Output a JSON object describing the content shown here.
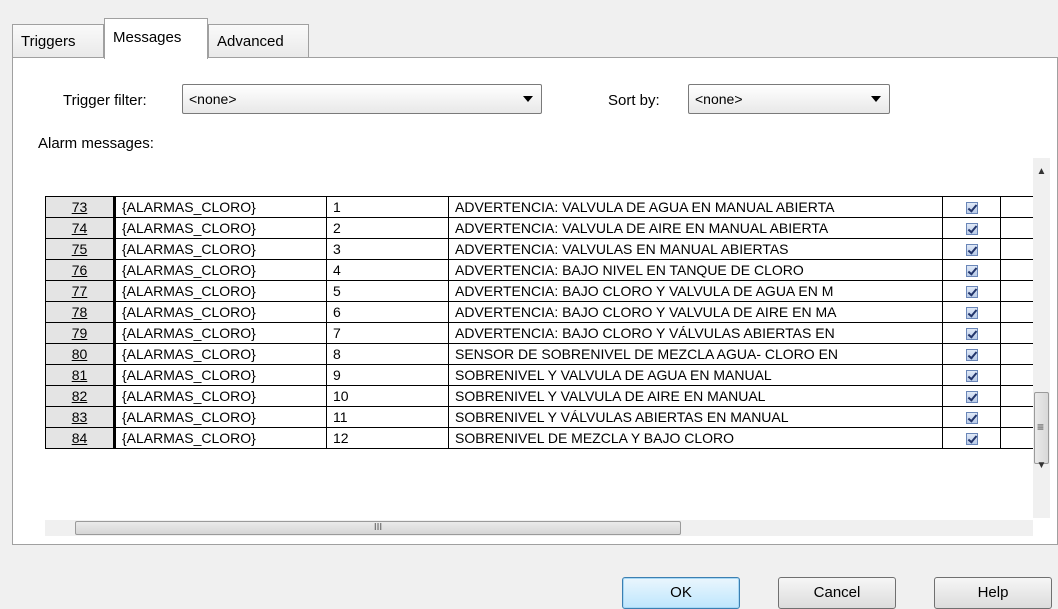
{
  "tabs": [
    "Triggers",
    "Messages",
    "Advanced"
  ],
  "filter": {
    "trigger_filter_label": "Trigger filter:",
    "trigger_filter_value": "<none>",
    "sort_by_label": "Sort by:",
    "sort_by_value": "<none>"
  },
  "alarm_messages_label": "Alarm messages:",
  "rows": [
    {
      "num": "73",
      "trigger": "{ALARMAS_CLORO}",
      "id": "1",
      "text": "ADVERTENCIA: VALVULA DE AGUA EN MANUAL ABIERTA",
      "checked": true
    },
    {
      "num": "74",
      "trigger": "{ALARMAS_CLORO}",
      "id": "2",
      "text": "ADVERTENCIA: VALVULA DE AIRE EN MANUAL ABIERTA",
      "checked": true
    },
    {
      "num": "75",
      "trigger": "{ALARMAS_CLORO}",
      "id": "3",
      "text": "ADVERTENCIA: VALVULAS EN MANUAL ABIERTAS",
      "checked": true
    },
    {
      "num": "76",
      "trigger": "{ALARMAS_CLORO}",
      "id": "4",
      "text": "ADVERTENCIA: BAJO NIVEL EN TANQUE DE CLORO",
      "checked": true
    },
    {
      "num": "77",
      "trigger": "{ALARMAS_CLORO}",
      "id": "5",
      "text": "ADVERTENCIA: BAJO CLORO Y VALVULA DE AGUA EN M",
      "checked": true
    },
    {
      "num": "78",
      "trigger": "{ALARMAS_CLORO}",
      "id": "6",
      "text": "ADVERTENCIA: BAJO CLORO Y VALVULA DE AIRE EN MA",
      "checked": true
    },
    {
      "num": "79",
      "trigger": "{ALARMAS_CLORO}",
      "id": "7",
      "text": "ADVERTENCIA: BAJO CLORO Y VÁLVULAS ABIERTAS EN",
      "checked": true
    },
    {
      "num": "80",
      "trigger": "{ALARMAS_CLORO}",
      "id": "8",
      "text": "SENSOR DE SOBRENIVEL DE MEZCLA  AGUA- CLORO EN",
      "checked": true
    },
    {
      "num": "81",
      "trigger": "{ALARMAS_CLORO}",
      "id": "9",
      "text": "SOBRENIVEL Y VALVULA DE AGUA EN MANUAL",
      "checked": true
    },
    {
      "num": "82",
      "trigger": "{ALARMAS_CLORO}",
      "id": "10",
      "text": "SOBRENIVEL Y VALVULA DE AIRE EN MANUAL",
      "checked": true
    },
    {
      "num": "83",
      "trigger": "{ALARMAS_CLORO}",
      "id": "11",
      "text": "SOBRENIVEL Y VÁLVULAS ABIERTAS EN MANUAL",
      "checked": true
    },
    {
      "num": "84",
      "trigger": "{ALARMAS_CLORO}",
      "id": "12",
      "text": "SOBRENIVEL DE MEZCLA Y BAJO CLORO",
      "checked": true
    }
  ],
  "scroll": {
    "up": "▲",
    "down": "▼",
    "grip_v": "≡",
    "grip_h": "III"
  },
  "buttons": {
    "ok": "OK",
    "cancel": "Cancel",
    "help": "Help"
  }
}
